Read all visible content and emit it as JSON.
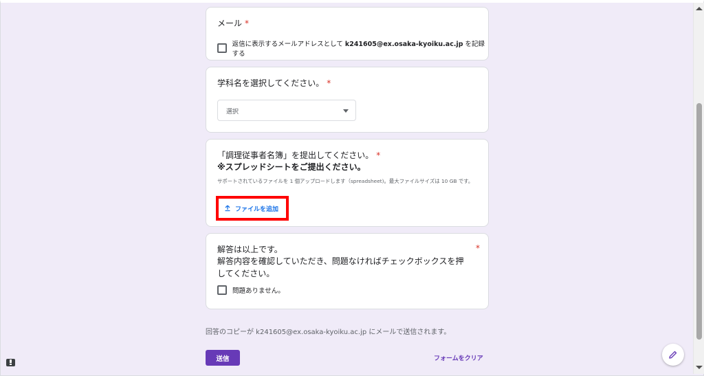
{
  "email_card": {
    "title": "メール",
    "required_mark": "*",
    "checkbox_label_prefix": "返信に表示するメールアドレスとして ",
    "email": "k241605@ex.osaka-kyoiku.ac.jp",
    "checkbox_label_suffix": " を記録する"
  },
  "dept_card": {
    "title": "学科名を選択してください。",
    "required_mark": "*",
    "select_value": "選択"
  },
  "upload_card": {
    "title_line1": "「調理従事者名簿」を提出してください。",
    "required_mark": "*",
    "title_line2": "※スプレッドシートをご提出ください。",
    "help_text": "サポートされているファイルを 1 個アップロードします（spreadsheet)。最大ファイルサイズは 10 GB です。",
    "add_file_label": "ファイルを追加",
    "highlight_color": "#ff0000"
  },
  "confirm_card": {
    "title_line1": "解答は以上です。",
    "title_line2": "解答内容を確認していただき、問題なければチェックボックスを押してください。",
    "required_mark": "*",
    "checkbox_label": "問題ありません。"
  },
  "footer": {
    "copy_notice": "回答のコピーが k241605@ex.osaka-kyoiku.ac.jp にメールで送信されます。",
    "submit_label": "送信",
    "clear_label": "フォームをクリア",
    "accent_color": "#673ab7"
  },
  "icons": {
    "upload": "upload-icon",
    "dropdown": "dropdown-arrow-icon",
    "edit": "pencil-icon",
    "feedback": "feedback-icon"
  }
}
